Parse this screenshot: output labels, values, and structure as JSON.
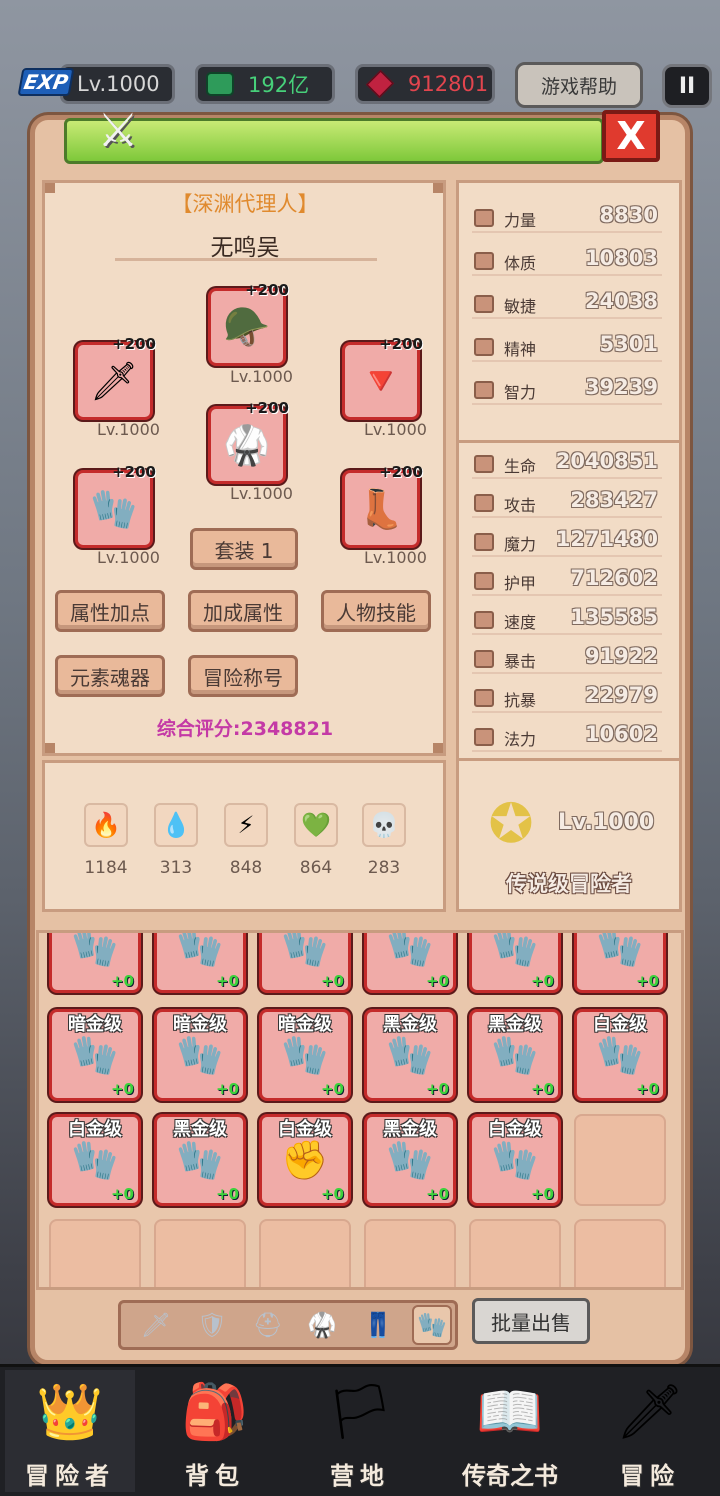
{
  "topbar": {
    "exp_badge": "EXP",
    "level": "Lv.1000",
    "gems": "192亿",
    "rubies": "912801",
    "help_label": "游戏帮助",
    "pause_label": "II"
  },
  "panel": {
    "close_label": "X"
  },
  "character": {
    "title": "【深渊代理人】",
    "name": "无鸣吴",
    "slots": [
      {
        "plus": "+200",
        "lv": "Lv.1000"
      },
      {
        "plus": "+200",
        "lv": "Lv.1000"
      },
      {
        "plus": "+200",
        "lv": "Lv.1000"
      },
      {
        "plus": "+200",
        "lv": "Lv.1000"
      },
      {
        "plus": "+200",
        "lv": "Lv.1000"
      },
      {
        "plus": "+200",
        "lv": "Lv.1000"
      }
    ],
    "set_button": "套装 1",
    "buttons": [
      "属性加点",
      "加成属性",
      "人物技能",
      "元素魂器",
      "冒险称号"
    ],
    "score": "综合评分:2348821"
  },
  "elements": [
    {
      "icon": "fire-icon",
      "value": "1184"
    },
    {
      "icon": "water-icon",
      "value": "313"
    },
    {
      "icon": "lightning-icon",
      "value": "848"
    },
    {
      "icon": "earth-icon",
      "value": "864"
    },
    {
      "icon": "skull-icon",
      "value": "283"
    }
  ],
  "base_stats": [
    {
      "label": "力量",
      "value": "8830"
    },
    {
      "label": "体质",
      "value": "10803"
    },
    {
      "label": "敏捷",
      "value": "24038"
    },
    {
      "label": "精神",
      "value": "5301"
    },
    {
      "label": "智力",
      "value": "39239"
    }
  ],
  "combat_stats": [
    {
      "label": "生命",
      "value": "2040851"
    },
    {
      "label": "攻击",
      "value": "283427"
    },
    {
      "label": "魔力",
      "value": "1271480"
    },
    {
      "label": "护甲",
      "value": "712602"
    },
    {
      "label": "速度",
      "value": "135585"
    },
    {
      "label": "暴击",
      "value": "91922"
    },
    {
      "label": "抗暴",
      "value": "22979"
    },
    {
      "label": "法力",
      "value": "10602"
    }
  ],
  "legend": {
    "level": "Lv.1000",
    "title": "传说级冒险者"
  },
  "inventory": {
    "row0": [
      {
        "tier": "",
        "plus": "+0"
      },
      {
        "tier": "",
        "plus": "+0"
      },
      {
        "tier": "",
        "plus": "+0"
      },
      {
        "tier": "",
        "plus": "+0"
      },
      {
        "tier": "",
        "plus": "+0"
      },
      {
        "tier": "",
        "plus": "+0"
      }
    ],
    "row1": [
      {
        "tier": "暗金级",
        "plus": "+0"
      },
      {
        "tier": "暗金级",
        "plus": "+0"
      },
      {
        "tier": "暗金级",
        "plus": "+0"
      },
      {
        "tier": "黑金级",
        "plus": "+0"
      },
      {
        "tier": "黑金级",
        "plus": "+0"
      },
      {
        "tier": "白金级",
        "plus": "+0"
      }
    ],
    "row2": [
      {
        "tier": "白金级",
        "plus": "+0"
      },
      {
        "tier": "黑金级",
        "plus": "+0"
      },
      {
        "tier": "白金级",
        "plus": "+0"
      },
      {
        "tier": "黑金级",
        "plus": "+0"
      },
      {
        "tier": "白金级",
        "plus": "+0"
      }
    ]
  },
  "tabs": [
    "sword-icon",
    "shield-icon",
    "helmet-icon",
    "armor-icon",
    "boots-icon",
    "gauntlet-icon"
  ],
  "bulk_sell": "批量出售",
  "nav": [
    "冒险者",
    "背包",
    "营地",
    "传奇之书",
    "冒险"
  ]
}
